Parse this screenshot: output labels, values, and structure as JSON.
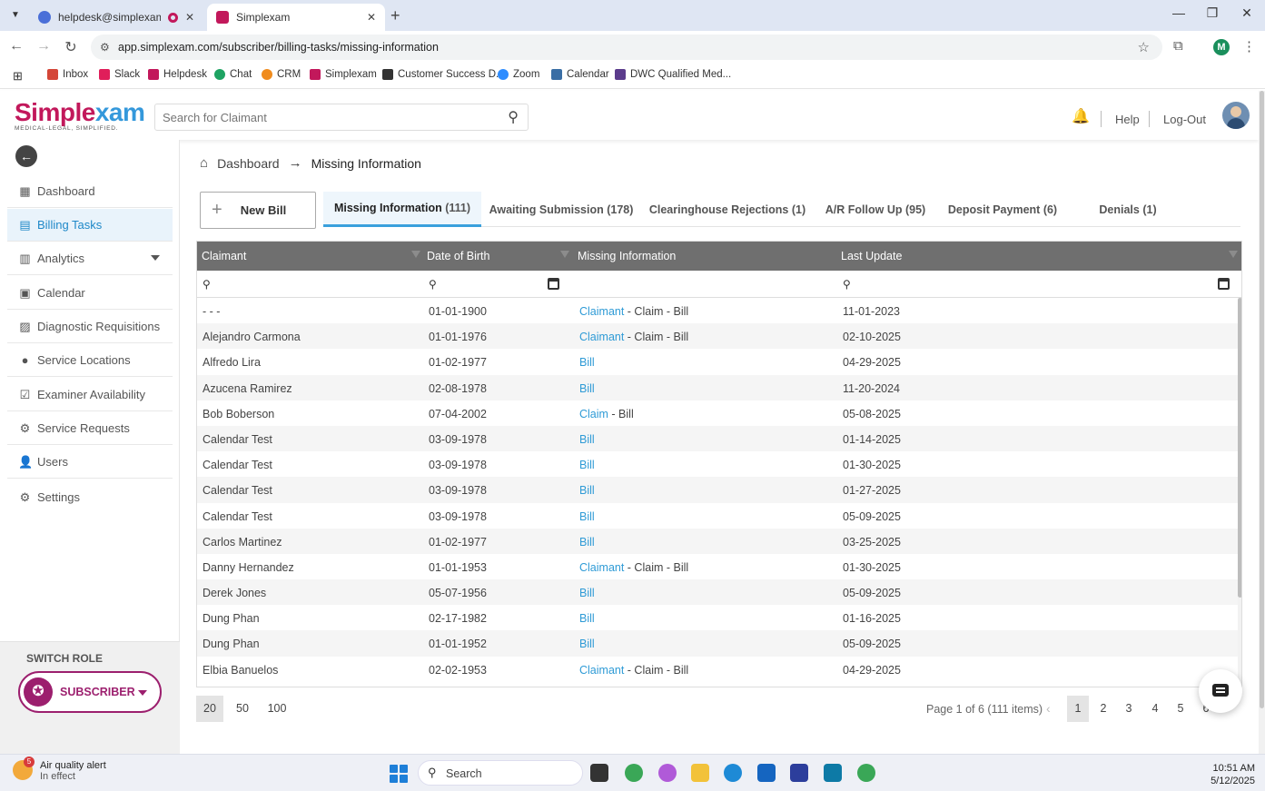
{
  "browser": {
    "tabs": [
      {
        "title": "helpdesk@simplexam.com",
        "active": false
      },
      {
        "title": "Simplexam",
        "active": true
      }
    ],
    "url": "app.simplexam.com/subscriber/billing-tasks/missing-information",
    "profile_initial": "M",
    "bookmarks": [
      "Inbox",
      "Slack",
      "Helpdesk",
      "Chat",
      "CRM",
      "Simplexam",
      "Customer Success D...",
      "Zoom",
      "Calendar",
      "DWC Qualified Med..."
    ]
  },
  "header": {
    "brand_main": "Simple",
    "brand_accent": "xam",
    "tagline": "MEDICAL-LEGAL, SIMPLIFIED.",
    "search_placeholder": "Search for Claimant",
    "help_label": "Help",
    "logout_label": "Log-Out"
  },
  "sidebar": {
    "items": [
      {
        "label": "Dashboard",
        "icon": "dashboard-icon"
      },
      {
        "label": "Billing Tasks",
        "icon": "billing-icon",
        "active": true
      },
      {
        "label": "Analytics",
        "icon": "analytics-icon"
      },
      {
        "label": "Calendar",
        "icon": "calendar-icon"
      },
      {
        "label": "Diagnostic Requisitions",
        "icon": "diagnostic-icon"
      },
      {
        "label": "Service Locations",
        "icon": "location-icon"
      },
      {
        "label": "Examiner Availability",
        "icon": "availability-icon"
      },
      {
        "label": "Service Requests",
        "icon": "gears-icon"
      },
      {
        "label": "Users",
        "icon": "user-icon"
      },
      {
        "label": "Settings",
        "icon": "gear-icon"
      }
    ],
    "switch_role_label": "SWITCH ROLE",
    "role": "SUBSCRIBER"
  },
  "breadcrumb": {
    "home": "Dashboard",
    "current": "Missing Information"
  },
  "toolbar": {
    "new_bill_label": "New Bill"
  },
  "tabs": [
    {
      "label": "Missing Information",
      "count": "(111)",
      "active": true
    },
    {
      "label": "Awaiting Submission",
      "count": "(178)"
    },
    {
      "label": "Clearinghouse Rejections",
      "count": "(1)"
    },
    {
      "label": "A/R Follow Up",
      "count": "(95)"
    },
    {
      "label": "Deposit Payment",
      "count": "(6)"
    },
    {
      "label": "Denials",
      "count": "(1)"
    }
  ],
  "table": {
    "columns": [
      "Claimant",
      "Date of Birth",
      "Missing Information",
      "Last Update"
    ],
    "rows": [
      {
        "claimant": "- - -",
        "dob": "01-01-1900",
        "missing_link": "Claimant",
        "missing_rest": " - Claim - Bill",
        "updated": "11-01-2023"
      },
      {
        "claimant": "Alejandro Carmona",
        "dob": "01-01-1976",
        "missing_link": "Claimant",
        "missing_rest": " - Claim - Bill",
        "updated": "02-10-2025"
      },
      {
        "claimant": "Alfredo Lira",
        "dob": "01-02-1977",
        "missing_link": "Bill",
        "missing_rest": "",
        "updated": "04-29-2025"
      },
      {
        "claimant": "Azucena Ramirez",
        "dob": "02-08-1978",
        "missing_link": "Bill",
        "missing_rest": "",
        "updated": "11-20-2024"
      },
      {
        "claimant": "Bob Boberson",
        "dob": "07-04-2002",
        "missing_link": "Claim",
        "missing_rest": " - Bill",
        "updated": "05-08-2025"
      },
      {
        "claimant": "Calendar Test",
        "dob": "03-09-1978",
        "missing_link": "Bill",
        "missing_rest": "",
        "updated": "01-14-2025"
      },
      {
        "claimant": "Calendar Test",
        "dob": "03-09-1978",
        "missing_link": "Bill",
        "missing_rest": "",
        "updated": "01-30-2025"
      },
      {
        "claimant": "Calendar Test",
        "dob": "03-09-1978",
        "missing_link": "Bill",
        "missing_rest": "",
        "updated": "01-27-2025"
      },
      {
        "claimant": "Calendar Test",
        "dob": "03-09-1978",
        "missing_link": "Bill",
        "missing_rest": "",
        "updated": "05-09-2025"
      },
      {
        "claimant": "Carlos Martinez",
        "dob": "01-02-1977",
        "missing_link": "Bill",
        "missing_rest": "",
        "updated": "03-25-2025"
      },
      {
        "claimant": "Danny Hernandez",
        "dob": "01-01-1953",
        "missing_link": "Claimant",
        "missing_rest": " - Claim - Bill",
        "updated": "01-30-2025"
      },
      {
        "claimant": "Derek Jones",
        "dob": "05-07-1956",
        "missing_link": "Bill",
        "missing_rest": "",
        "updated": "05-09-2025"
      },
      {
        "claimant": "Dung Phan",
        "dob": "02-17-1982",
        "missing_link": "Bill",
        "missing_rest": "",
        "updated": "01-16-2025"
      },
      {
        "claimant": "Dung Phan",
        "dob": "01-01-1952",
        "missing_link": "Bill",
        "missing_rest": "",
        "updated": "05-09-2025"
      },
      {
        "claimant": "Elbia Banuelos",
        "dob": "02-02-1953",
        "missing_link": "Claimant",
        "missing_rest": " - Claim - Bill",
        "updated": "04-29-2025"
      }
    ]
  },
  "pager": {
    "sizes": [
      "20",
      "50",
      "100"
    ],
    "info": "Page 1 of 6 (111 items)",
    "pages": [
      "1",
      "2",
      "3",
      "4",
      "5",
      "6"
    ]
  },
  "taskbar": {
    "weather_badge": "5",
    "weather_title": "Air quality alert",
    "weather_sub": "In effect",
    "search_label": "Search",
    "time": "10:51 AM",
    "date": "5/12/2025"
  }
}
